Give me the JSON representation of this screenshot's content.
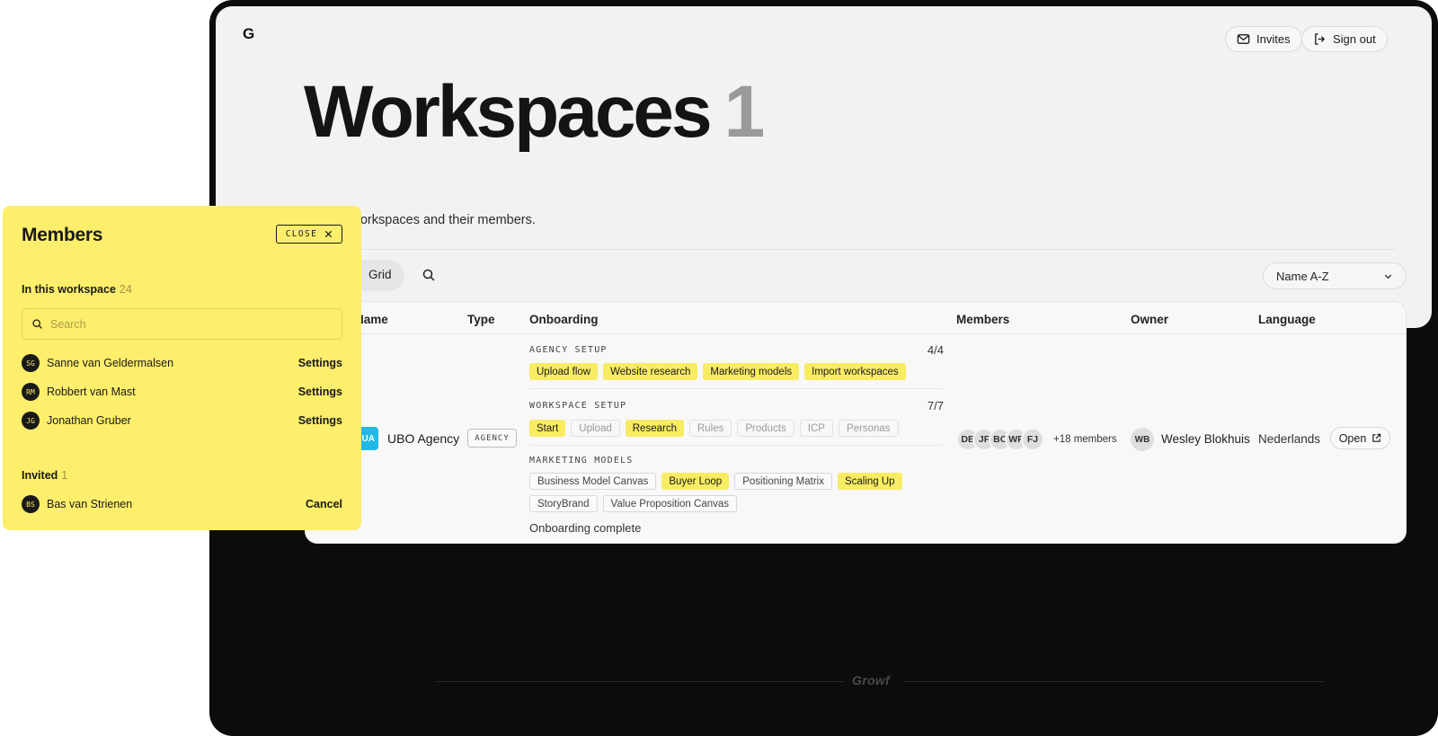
{
  "app": {
    "logo": "G",
    "footer_brand": "Growf"
  },
  "header": {
    "invites_label": "Invites",
    "signout_label": "Sign out"
  },
  "page": {
    "title": "Workspaces",
    "count": "1",
    "subtitle": "ge your workspaces and their members."
  },
  "toolbar": {
    "view_label": "Grid",
    "sort_value": "Name A-Z"
  },
  "table": {
    "headers": {
      "name": "Name",
      "type": "Type",
      "onboarding": "Onboarding",
      "members": "Members",
      "owner": "Owner",
      "language": "Language"
    },
    "row": {
      "initials": "UA",
      "name": "UBO Agency",
      "type": "AGENCY",
      "onboarding": {
        "agency_setup": {
          "label": "AGENCY SETUP",
          "count": "4/4",
          "steps": [
            {
              "label": "Upload flow",
              "done": true
            },
            {
              "label": "Website research",
              "done": true
            },
            {
              "label": "Marketing models",
              "done": true
            },
            {
              "label": "Import workspaces",
              "done": true
            }
          ]
        },
        "workspace_setup": {
          "label": "WORKSPACE SETUP",
          "count": "7/7",
          "steps": [
            {
              "label": "Start",
              "done": true
            },
            {
              "label": "Upload",
              "done": false
            },
            {
              "label": "Research",
              "done": true
            },
            {
              "label": "Rules",
              "done": false
            },
            {
              "label": "Products",
              "done": false
            },
            {
              "label": "ICP",
              "done": false
            },
            {
              "label": "Personas",
              "done": false
            }
          ]
        },
        "marketing_models": {
          "label": "MARKETING MODELS",
          "steps": [
            {
              "label": "Business Model Canvas",
              "active": false
            },
            {
              "label": "Buyer Loop",
              "active": true
            },
            {
              "label": "Positioning Matrix",
              "active": false
            },
            {
              "label": "Scaling Up",
              "active": true
            },
            {
              "label": "StoryBrand",
              "active": false
            },
            {
              "label": "Value Proposition Canvas",
              "active": false
            }
          ]
        },
        "status": "Onboarding complete"
      },
      "members": [
        "DB",
        "JF",
        "BO",
        "WR",
        "FJ"
      ],
      "more_members": "+18 members",
      "owner": {
        "initials": "WB",
        "name": "Wesley Blokhuis"
      },
      "language": "Nederlands",
      "open_label": "Open"
    }
  },
  "members_panel": {
    "title": "Members",
    "close_label": "CLOSE",
    "in_workspace_label": "In this workspace",
    "in_workspace_count": "24",
    "search_placeholder": "Search",
    "members": [
      {
        "initials": "SG",
        "name": "Sanne van Geldermalsen",
        "action": "Settings"
      },
      {
        "initials": "RM",
        "name": "Robbert van Mast",
        "action": "Settings"
      },
      {
        "initials": "JG",
        "name": "Jonathan Gruber",
        "action": "Settings"
      }
    ],
    "invited_label": "Invited",
    "invited_count": "1",
    "invited": [
      {
        "initials": "BS",
        "name": "Bas van Strienen",
        "action": "Cancel"
      }
    ]
  },
  "colors": {
    "accent_yellow": "#fdee6b",
    "chip_yellow": "#f8ec63",
    "frame_dark": "#0d0c0b",
    "badge_blue": "#22b8e6"
  }
}
